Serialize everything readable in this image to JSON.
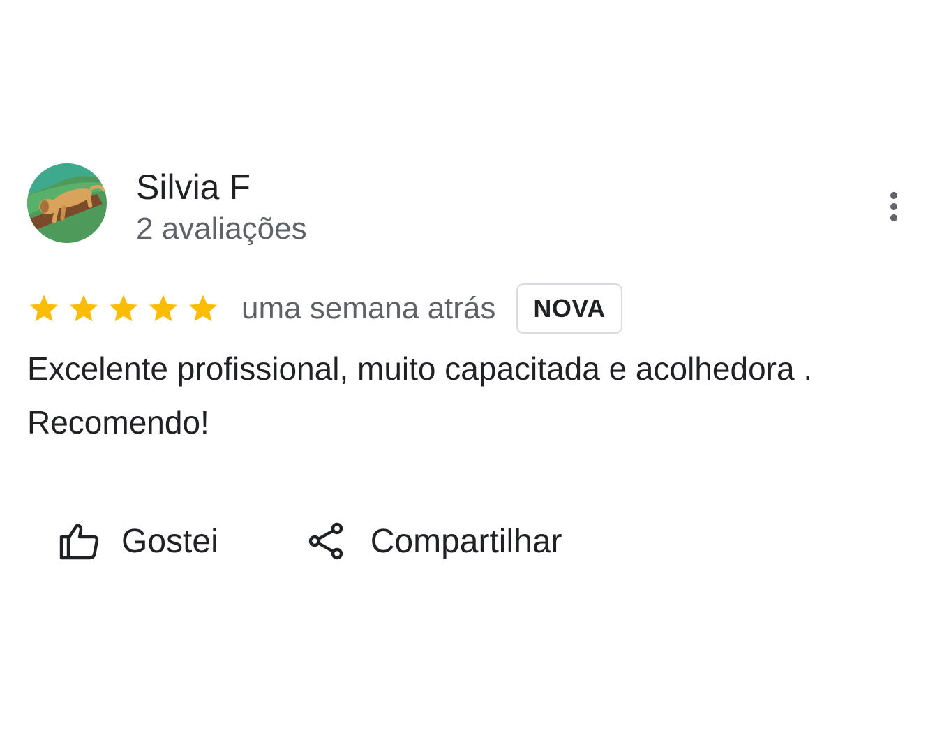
{
  "reviewer": {
    "name": "Silvia F",
    "review_count": "2 avaliações",
    "avatar_icon": "dog-avatar"
  },
  "review": {
    "rating": 5,
    "rating_max": 5,
    "star_color": "#fbbc04",
    "date": "uma semana atrás",
    "badge": "NOVA",
    "text": "Excelente profissional, muito capacitada e acolhedora . Recomendo!"
  },
  "menu": {
    "icon": "more-vertical-icon"
  },
  "actions": {
    "like": {
      "label": "Gostei",
      "icon": "thumbs-up-icon"
    },
    "share": {
      "label": "Compartilhar",
      "icon": "share-icon"
    }
  }
}
